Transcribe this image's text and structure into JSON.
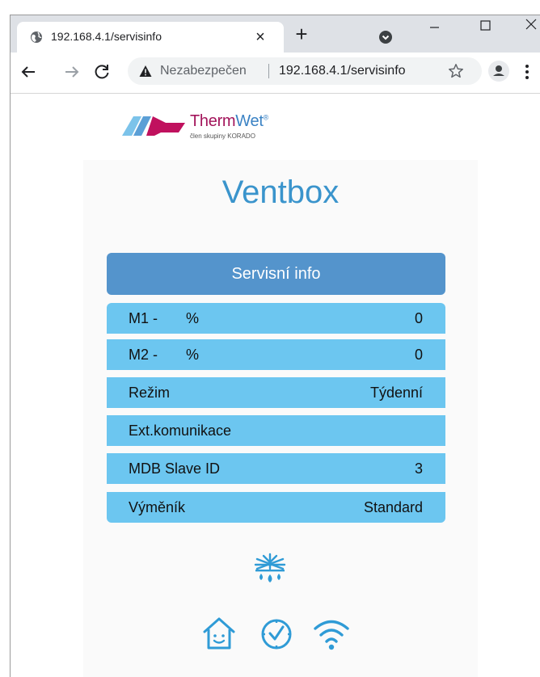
{
  "browser": {
    "tab_title": "192.168.4.1/servisinfo",
    "security_label": "Nezabezpečen",
    "url": "192.168.4.1/servisinfo"
  },
  "page": {
    "logo": {
      "brand_part1": "Therm",
      "brand_part2": "Wet",
      "registered": "®",
      "tagline": "člen skupiny KORADO"
    },
    "title": "Ventbox",
    "panel_title": "Servisní info",
    "rows": [
      {
        "label": "M1 -",
        "unit": "%",
        "value": "0"
      },
      {
        "label": "M2 -",
        "unit": "%",
        "value": "0"
      },
      {
        "label": "Režim",
        "unit": "",
        "value": "Týdenní"
      },
      {
        "label": "Ext.komunikace",
        "unit": "",
        "value": ""
      },
      {
        "label": "MDB Slave ID",
        "unit": "",
        "value": "3"
      },
      {
        "label": "Výměník",
        "unit": "",
        "value": "Standard"
      }
    ],
    "icons": [
      "snowflake-drops-icon",
      "home-icon",
      "clock-icon",
      "wifi-icon"
    ]
  },
  "colors": {
    "header": "#5494cc",
    "row": "#6cc6f0",
    "title": "#3a94cc",
    "icon": "#2f9bd6"
  }
}
